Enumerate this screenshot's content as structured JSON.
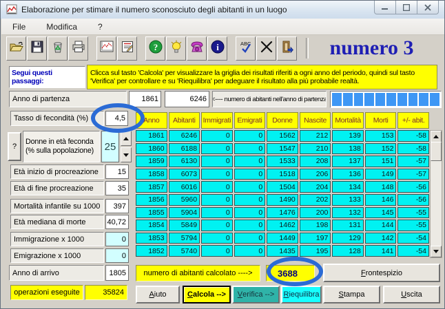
{
  "window": {
    "title": "Elaborazione per stimare il numero sconosciuto degli abitanti in un luogo",
    "annotation": "numero 3"
  },
  "menu": {
    "items": [
      "File",
      "Modifica",
      "?"
    ]
  },
  "toolbar": {
    "icons": [
      "open-icon",
      "save-icon",
      "delete-icon",
      "print-icon",
      "chart-icon",
      "report-icon",
      "help-icon",
      "tip-icon",
      "contact-icon",
      "info-icon",
      "spellcheck-icon",
      "close-x-icon",
      "exit-icon"
    ],
    "spellcheck_text": "ABC"
  },
  "instructions": {
    "label": "Segui questi passaggi:",
    "text": "Clicca sul tasto 'Calcola' per visualizzare la griglia dei risultati riferiti a ogni anno del periodo, quindi sul tasto 'Verifica' per controllare e su 'Riequilibra' per adeguare il risultato alla più probabile realtà."
  },
  "start_row": {
    "label": "Anno di partenza",
    "year": "1861",
    "population": "6246",
    "hint": "<---- numero di abitanti nell'anno di partenza",
    "progress_segments": 10
  },
  "parameters": {
    "fertility_label": "Tasso di fecondità (%)",
    "fertility_value": "4,5",
    "fertile_women_button": "?",
    "fertile_women_line1": "Donne in età feconda",
    "fertile_women_line2": "(% sulla popolazione)",
    "fertile_women_value": "25",
    "rows": [
      {
        "label": "Età inizio di procreazione",
        "value": "15"
      },
      {
        "label": "Età di fine procreazione",
        "value": "35"
      },
      {
        "label": "Mortalità infantile su 1000",
        "value": "397"
      },
      {
        "label": "Età mediana di morte",
        "value": "40,72"
      },
      {
        "label": "Immigrazione x 1000",
        "value": "0"
      },
      {
        "label": "Emigrazione x 1000",
        "value": "0"
      }
    ]
  },
  "grid": {
    "headers": [
      "Anno",
      "Abitanti",
      "Immigrati",
      "Emigrati",
      "Donne",
      "Nascite",
      "Mortalità",
      "Morti",
      "+/- abit."
    ],
    "rows": [
      [
        "1861",
        "6246",
        "0",
        "0",
        "1562",
        "212",
        "139",
        "153",
        "-58"
      ],
      [
        "1860",
        "6188",
        "0",
        "0",
        "1547",
        "210",
        "138",
        "152",
        "-58"
      ],
      [
        "1859",
        "6130",
        "0",
        "0",
        "1533",
        "208",
        "137",
        "151",
        "-57"
      ],
      [
        "1858",
        "6073",
        "0",
        "0",
        "1518",
        "206",
        "136",
        "149",
        "-57"
      ],
      [
        "1857",
        "6016",
        "0",
        "0",
        "1504",
        "204",
        "134",
        "148",
        "-56"
      ],
      [
        "1856",
        "5960",
        "0",
        "0",
        "1490",
        "202",
        "133",
        "146",
        "-56"
      ],
      [
        "1855",
        "5904",
        "0",
        "0",
        "1476",
        "200",
        "132",
        "145",
        "-55"
      ],
      [
        "1854",
        "5849",
        "0",
        "0",
        "1462",
        "198",
        "131",
        "144",
        "-55"
      ],
      [
        "1853",
        "5794",
        "0",
        "0",
        "1449",
        "197",
        "129",
        "142",
        "-54"
      ],
      [
        "1852",
        "5740",
        "0",
        "0",
        "1435",
        "195",
        "128",
        "141",
        "-54"
      ]
    ]
  },
  "result": {
    "arrival_label": "Anno di arrivo",
    "arrival_value": "1805",
    "ops_label": "operazioni eseguite",
    "ops_value": "35824",
    "calc_label": "numero di abitanti calcolato  ---->",
    "calc_value": "3688"
  },
  "buttons": {
    "frontespizio": "Frontespizio",
    "aiuto": "Aiuto",
    "calcola": "Calcola -->",
    "verifica": "Verifica -->",
    "riequilibra": "Riequilibra",
    "stampa": "Stampa",
    "uscita": "Uscita"
  },
  "colors": {
    "highlight_yellow": "#FFFF00",
    "grid_cyan": "#00F2F2",
    "teal_button": "#2FB3A8",
    "cyan_button": "#17FFFF",
    "annotation_ellipse": "#2B6BD5",
    "annotation_text": "#1F1FB4",
    "progress_blue": "#3E97F5"
  }
}
